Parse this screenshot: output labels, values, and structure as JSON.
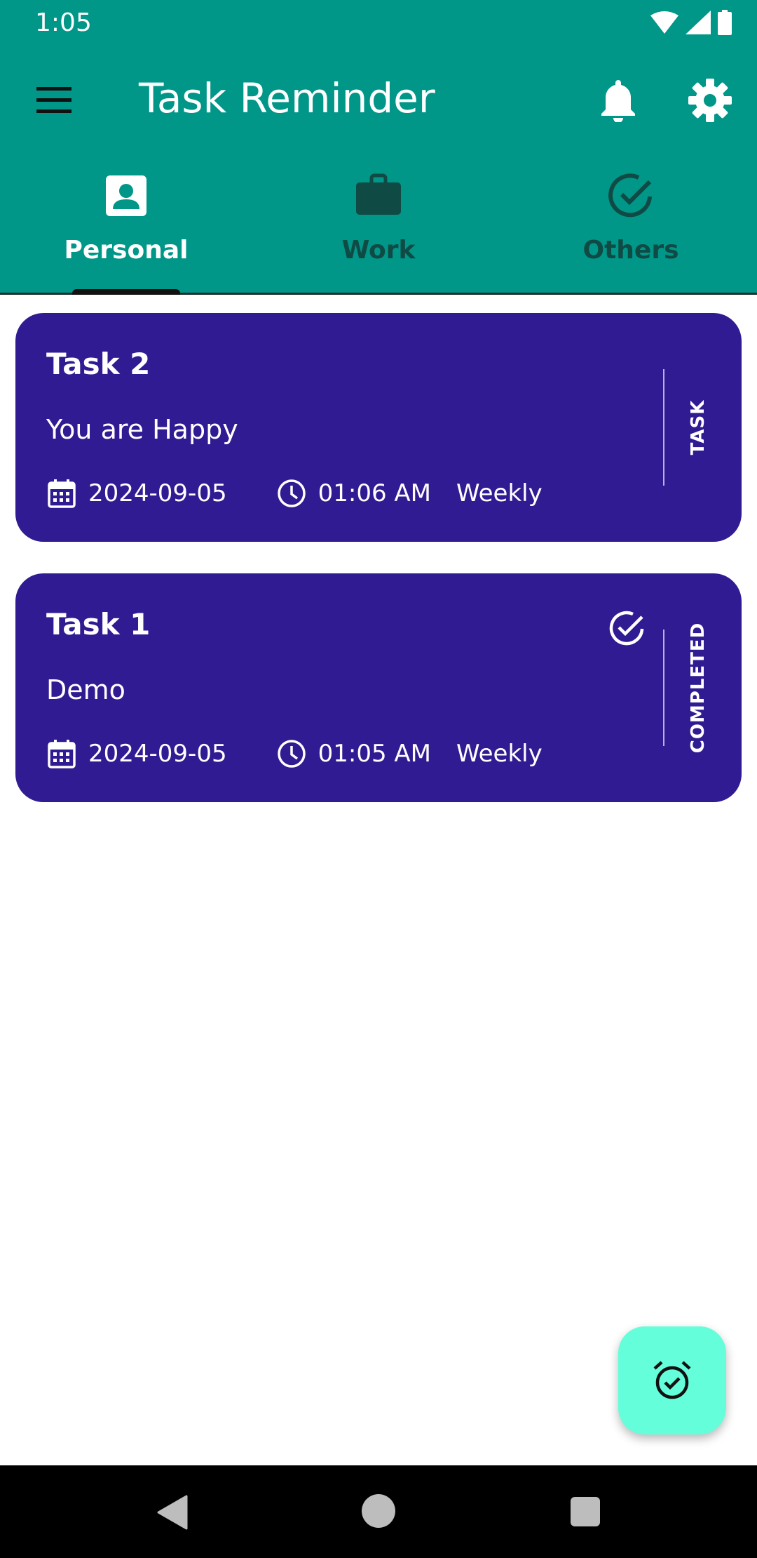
{
  "status_bar": {
    "time": "1:05",
    "icons": [
      "wifi-icon",
      "signal-icon",
      "battery-icon"
    ]
  },
  "toolbar": {
    "title": "Task Reminder",
    "menu_icon": "menu-icon",
    "bell_icon": "bell-icon",
    "settings_icon": "gear-icon"
  },
  "colors": {
    "appbar": "#009688",
    "card": "#311b92",
    "fab": "#64ffda",
    "tab_inactive": "#0f4a45"
  },
  "tabs": [
    {
      "label": "Personal",
      "icon": "contact-card-icon",
      "active": true
    },
    {
      "label": "Work",
      "icon": "briefcase-icon",
      "active": false
    },
    {
      "label": "Others",
      "icon": "check-circle-icon",
      "active": false
    }
  ],
  "tasks": [
    {
      "title": "Task 2",
      "description": "You are Happy",
      "date": "2024-09-05",
      "time": "01:06 AM",
      "repeat": "Weekly",
      "status": "TASK",
      "completed": false
    },
    {
      "title": "Task 1",
      "description": "Demo",
      "date": "2024-09-05",
      "time": "01:05 AM",
      "repeat": "Weekly",
      "status": "COMPLETED",
      "completed": true
    }
  ],
  "fab": {
    "icon": "alarm-check-icon"
  },
  "nav_bar": {
    "back_icon": "back-triangle-icon",
    "home_icon": "home-circle-icon",
    "recents_icon": "recents-square-icon"
  }
}
